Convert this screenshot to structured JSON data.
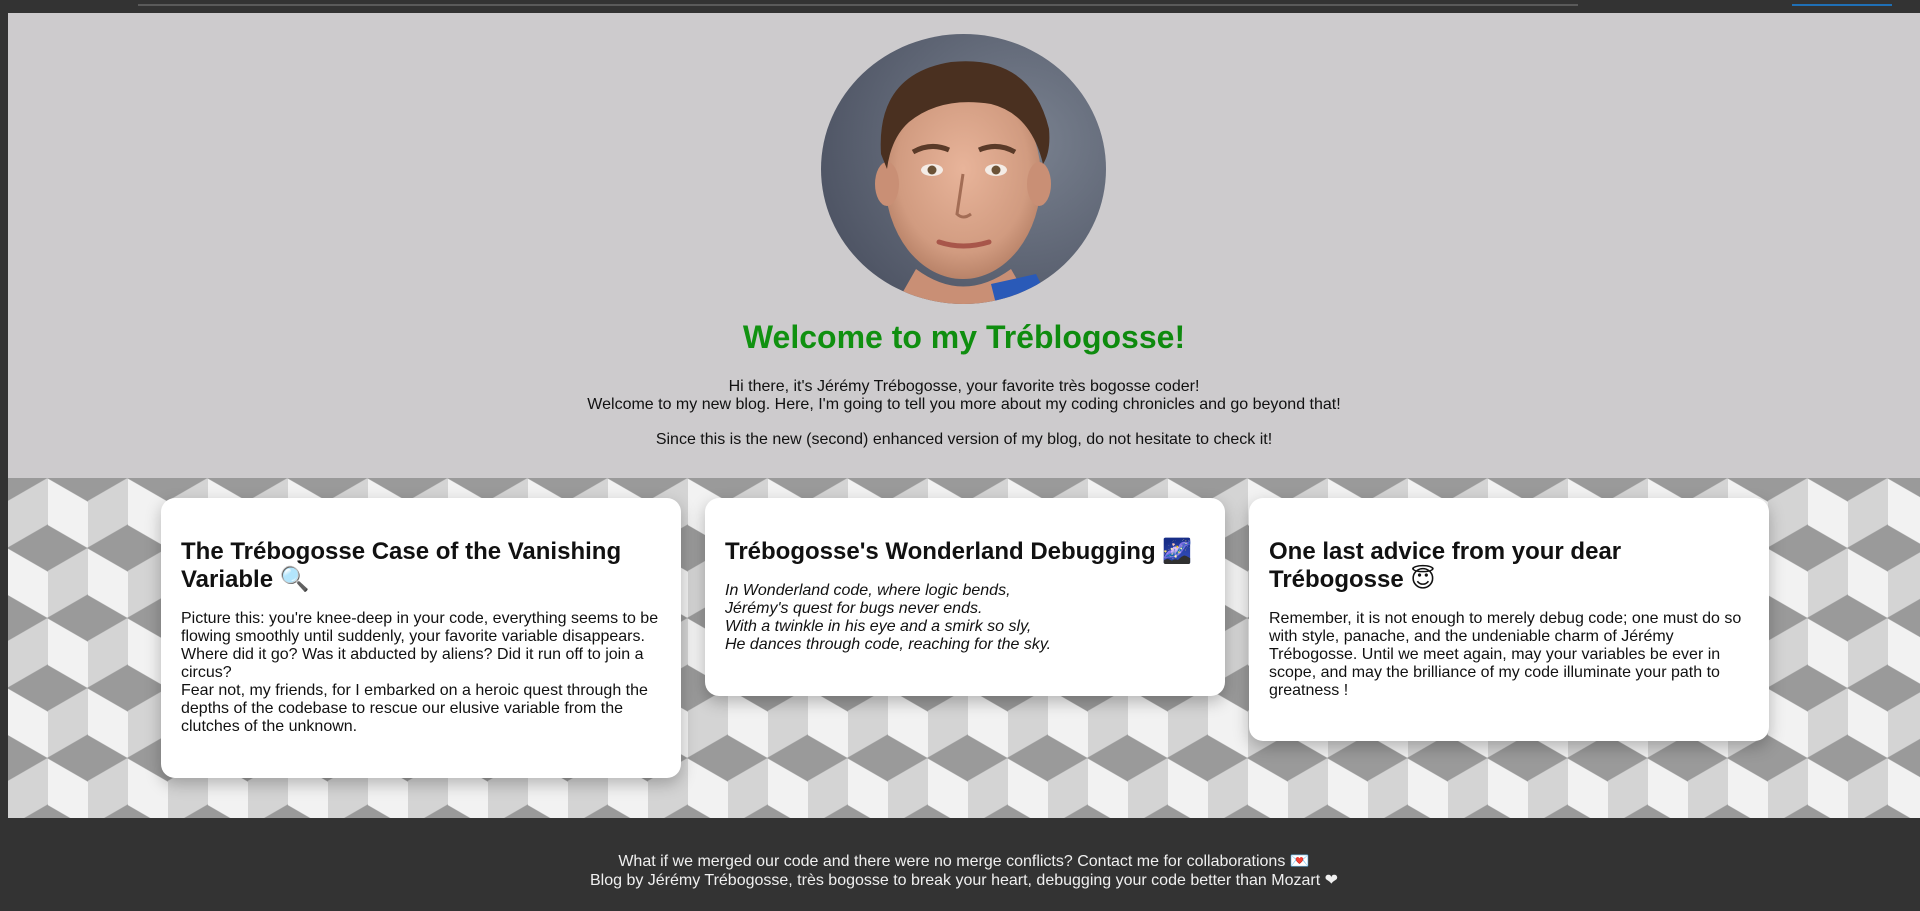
{
  "hero": {
    "title": "Welcome to my Tréblogosse!",
    "line1": "Hi there, it's Jérémy Trébogosse, your favorite très bogosse coder!",
    "line2": "Welcome to my new blog. Here, I'm going to tell you more about my coding chronicles and go beyond that!",
    "line3": "Since this is the new (second) enhanced version of my blog, do not hesitate to check it!"
  },
  "cards": [
    {
      "title": "The Trébogosse Case of the Vanishing Variable 🔍",
      "paragraphs": [
        "Picture this: you're knee-deep in your code, everything seems to be flowing smoothly until suddenly, your favorite variable disappears. Where did it go? Was it abducted by aliens? Did it run off to join a circus?",
        "Fear not, my friends, for I embarked on a heroic quest through the depths of the codebase to rescue our elusive variable from the clutches of the unknown."
      ]
    },
    {
      "title": "Trébogosse's Wonderland Debugging 🌌",
      "poem": [
        "In Wonderland code, where logic bends,",
        "Jérémy's quest for bugs never ends.",
        "With a twinkle in his eye and a smirk so sly,",
        "He dances through code, reaching for the sky."
      ]
    },
    {
      "title": "One last advice from your dear Trébogosse 😇",
      "paragraphs": [
        "Remember, it is not enough to merely debug code; one must do so with style, panache, and the undeniable charm of Jérémy Trébogosse. Until we meet again, may your variables be ever in scope, and may the brilliance of my code illuminate your path to greatness !"
      ]
    }
  ],
  "footer": {
    "line1": "What if we merged our code and there were no merge conflicts? Contact me for collaborations 💌",
    "line2": "Blog by Jérémy Trébogosse, très bogosse to break your heart, debugging your code better than Mozart ❤"
  },
  "colors": {
    "hero_bg": "#cdcbcd",
    "title_green": "#0e8a0e",
    "footer_bg": "#333333",
    "card_bg": "#ffffff"
  }
}
